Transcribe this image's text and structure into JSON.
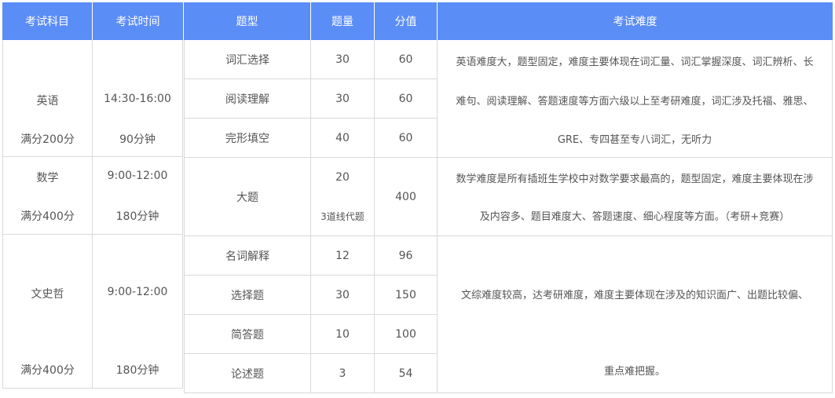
{
  "left_header": {
    "subject": "考试科目",
    "time": "考试时间"
  },
  "right_header": {
    "type": "题型",
    "count": "题量",
    "score": "分值",
    "difficulty": "考试难度"
  },
  "left_rows": [
    {
      "subject": "英语",
      "full_score": "满分200分",
      "time": "14:30-16:00",
      "duration": "90分钟"
    },
    {
      "subject": "数学",
      "full_score": "满分400分",
      "time": "9:00-12:00",
      "duration": "180分钟"
    },
    {
      "subject": "文史哲",
      "full_score": "满分400分",
      "time": "9:00-12:00",
      "duration": "180分钟"
    }
  ],
  "right_rows": [
    {
      "type": "词汇选择",
      "count": "30",
      "score": "60"
    },
    {
      "type": "阅读理解",
      "count": "30",
      "score": "60"
    },
    {
      "type": "完形填空",
      "count": "40",
      "score": "60"
    },
    {
      "type": "大题",
      "count": "20",
      "count_note": "3道线代题",
      "score": "400"
    },
    {
      "type": "名词解释",
      "count": "12",
      "score": "96"
    },
    {
      "type": "选择题",
      "count": "30",
      "score": "150"
    },
    {
      "type": "简答题",
      "count": "10",
      "score": "100"
    },
    {
      "type": "论述题",
      "count": "3",
      "score": "54"
    }
  ],
  "difficulty": {
    "english": [
      "英语难度大，题型固定，难度主要体现在词汇量、词汇掌握深度、词汇辨析、长",
      "难句、阅读理解、答题速度等方面六级以上至考研难度，词汇涉及托福、雅思、",
      "GRE、专四甚至专八词汇，无听力"
    ],
    "math": [
      "数学难度是所有插班生学校中对数学要求最高的，题型固定，难度主要体现在涉",
      "及内容多、题目难度大、答题速度、细心程度等方面。（考研+竞赛）"
    ],
    "wenshizhe": [
      "文综难度较高，达考研难度，难度主要体现在涉及的知识面广、出题比较偏、",
      "重点难把握。"
    ]
  }
}
